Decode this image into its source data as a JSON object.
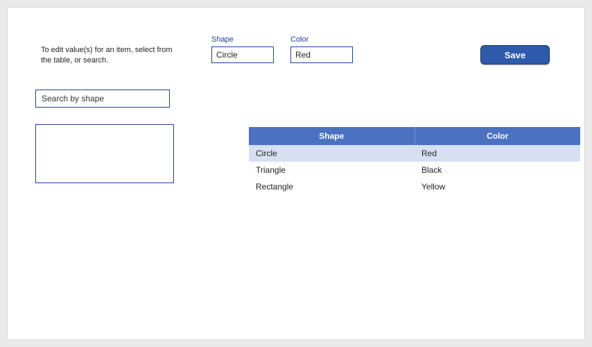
{
  "instruction": "To edit value(s) for an item, select from the table, or search.",
  "fields": {
    "shape": {
      "label": "Shape",
      "value": "Circle"
    },
    "color": {
      "label": "Color",
      "value": "Red"
    }
  },
  "save_label": "Save",
  "search": {
    "placeholder": "Search by shape",
    "value": ""
  },
  "table": {
    "headers": {
      "shape": "Shape",
      "color": "Color"
    },
    "rows": [
      {
        "shape": "Circle",
        "color": "Red",
        "selected": true
      },
      {
        "shape": "Triangle",
        "color": "Black",
        "selected": false
      },
      {
        "shape": "Rectangle",
        "color": "Yellow",
        "selected": false
      }
    ]
  }
}
